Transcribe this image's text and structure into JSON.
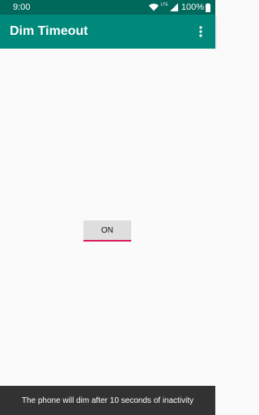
{
  "status_bar": {
    "time": "9:00",
    "network": "LTE",
    "battery": "100%",
    "icons": [
      "wifi-icon",
      "signal-icon",
      "battery-icon"
    ]
  },
  "app_bar": {
    "title": "Dim Timeout",
    "menu_icon": "more-vert-icon"
  },
  "main": {
    "toggle_label": "ON"
  },
  "snackbar": {
    "message": "The phone will dim after 10 seconds of inactivity"
  },
  "colors": {
    "status_bar": "#00695c",
    "app_bar": "#00897b",
    "accent": "#d81b60",
    "snackbar": "#323232"
  }
}
